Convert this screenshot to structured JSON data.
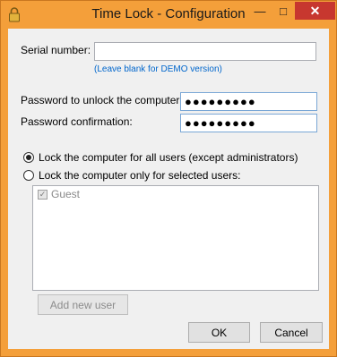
{
  "window": {
    "title": "Time Lock - Configuration",
    "minimize": "—",
    "maximize": "□",
    "close": "✕"
  },
  "serial": {
    "label": "Serial number:",
    "value": "",
    "hint": "(Leave blank for DEMO version)"
  },
  "password": {
    "label": "Password to unlock the computer:",
    "value": "●●●●●●●●●"
  },
  "confirm": {
    "label": "Password confirmation:",
    "value": "●●●●●●●●●"
  },
  "lock_mode": {
    "options": [
      {
        "label": "Lock the computer for all users (except administrators)",
        "selected": true
      },
      {
        "label": "Lock the computer only for selected users:",
        "selected": false
      }
    ]
  },
  "users": [
    {
      "label": "Guest",
      "checked": true
    }
  ],
  "buttons": {
    "add_user": "Add new user",
    "ok": "OK",
    "cancel": "Cancel"
  },
  "colors": {
    "titlebar": "#f49f3a",
    "close": "#c7372f",
    "hint": "#0066cc",
    "focus_border": "#7aa7d6"
  }
}
